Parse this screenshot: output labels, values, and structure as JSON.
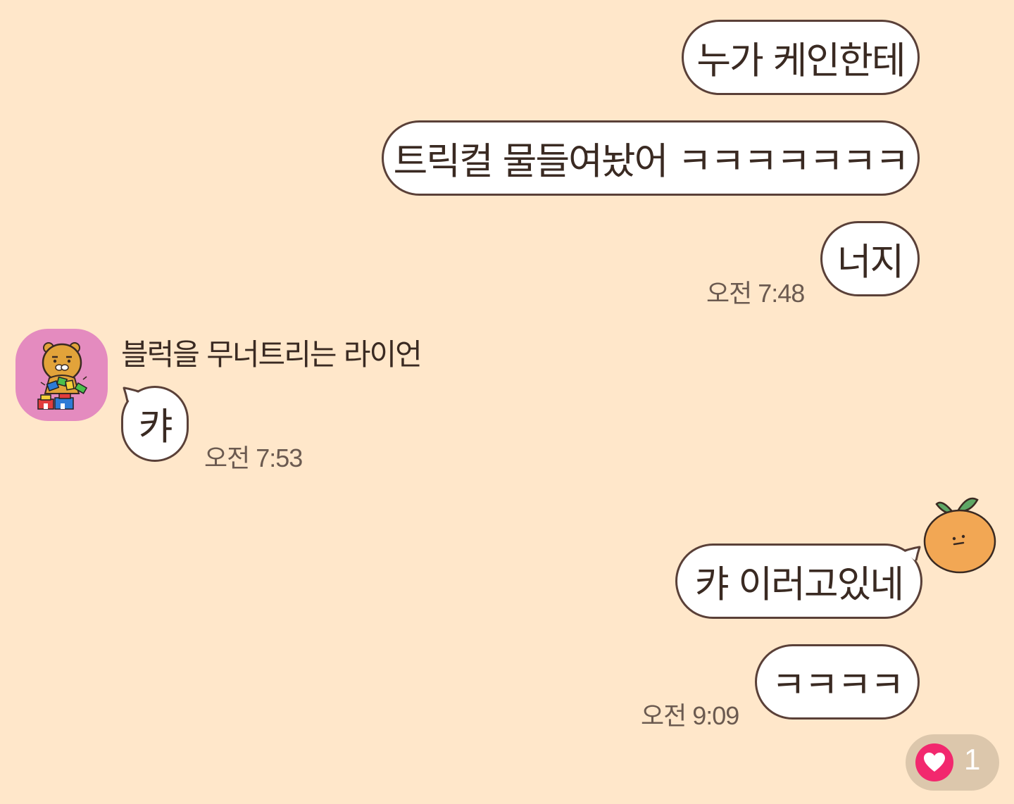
{
  "messages": {
    "m1": "누가 케인한테",
    "m2": "트릭컬 물들여놨어 ㅋㅋㅋㅋㅋㅋㅋ",
    "m3": "너지",
    "t1": "오전 7:48",
    "sender": "블럭을 무너트리는 라이언",
    "m4": "캬",
    "t2": "오전 7:53",
    "m5": "캬 이러고있네",
    "m6": "ㅋㅋㅋㅋ",
    "t3": "오전 9:09"
  },
  "reaction": {
    "icon": "heart-icon",
    "count": "1"
  },
  "colors": {
    "background": "#FFE7CA",
    "bubble": "#FFFFFF",
    "bubble_border": "#5A4038",
    "avatar_bg": "#E48BBF",
    "reaction_bg": "#DCC7AC",
    "heart": "#F2286E"
  }
}
